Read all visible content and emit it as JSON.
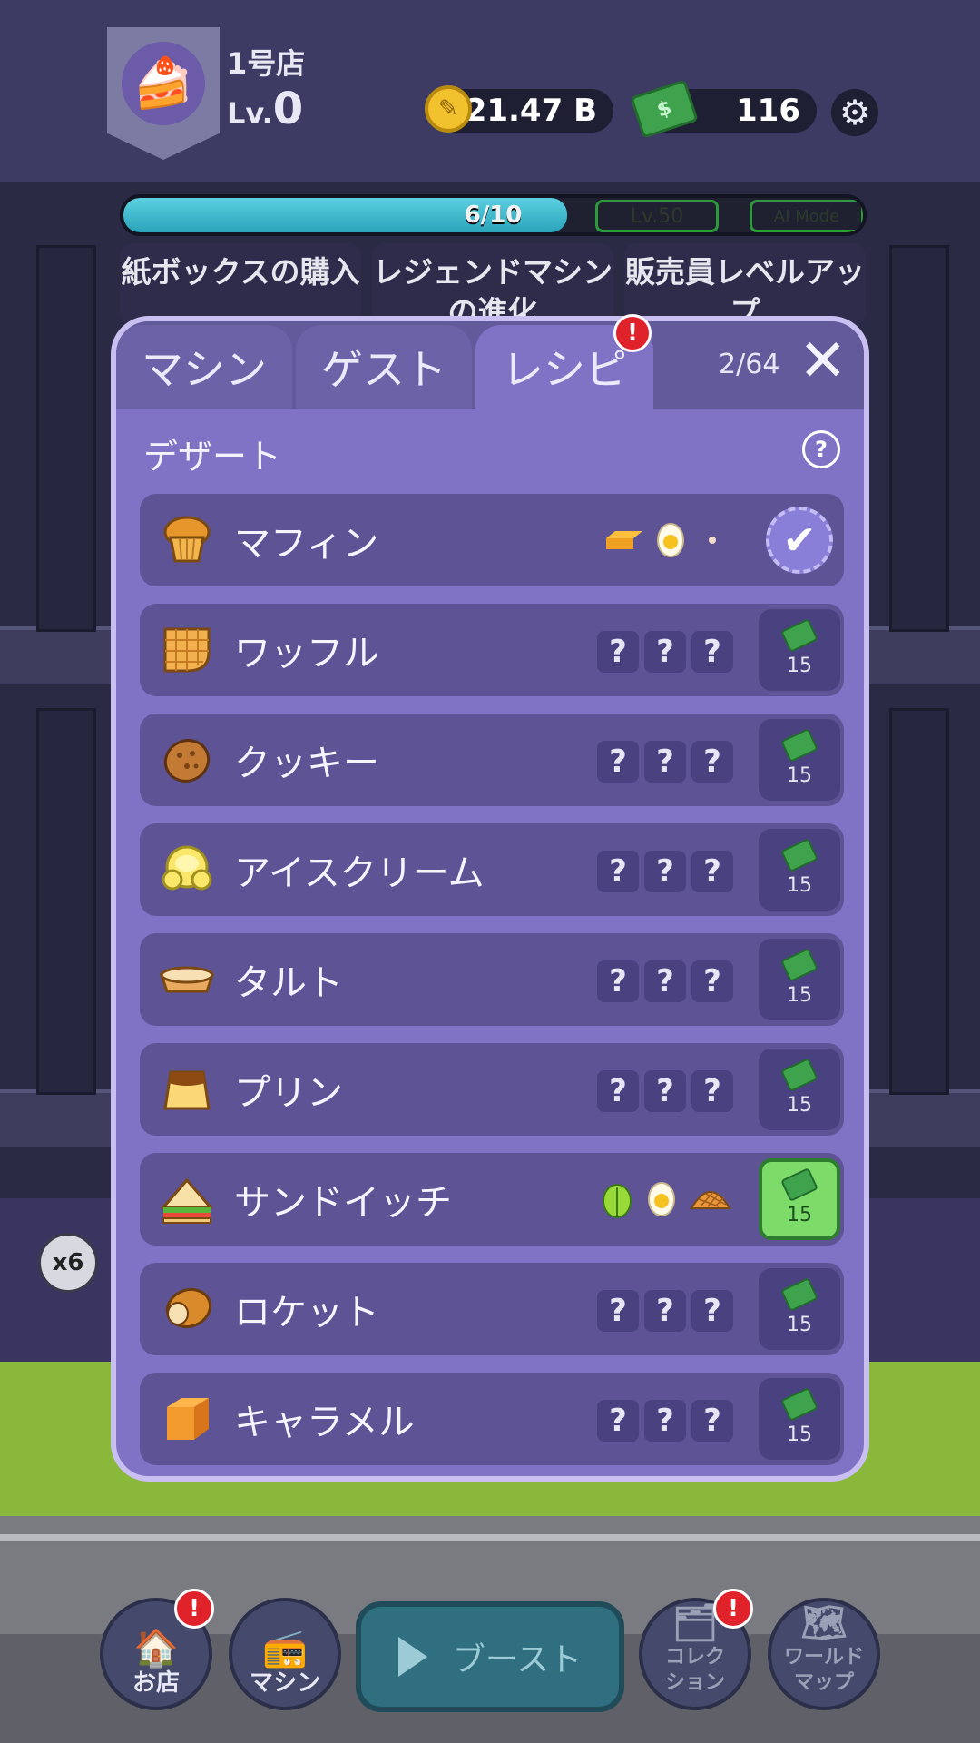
{
  "header": {
    "store_name": "1号店",
    "level_prefix": "Lv.",
    "level_value": "0",
    "coins": "21.47 B",
    "cash": "116"
  },
  "progress": {
    "text": "6/10",
    "fraction": 0.6,
    "milestone_lv": "Lv.50",
    "milestone_ai": "AI Mode"
  },
  "tasks": [
    {
      "label": "紙ボックスの購入"
    },
    {
      "label": "レジェンドマシンの進化"
    },
    {
      "label": "販売員レベルアップ"
    }
  ],
  "dialog": {
    "tabs": [
      {
        "label": "マシン"
      },
      {
        "label": "ゲスト"
      },
      {
        "label": "レシピ"
      }
    ],
    "tab_badge": "!",
    "count": "2/64",
    "close": "✕",
    "section_title": "デザート",
    "help": "?",
    "recipes": [
      {
        "name": "マフィン",
        "status": "unlocked",
        "price": ""
      },
      {
        "name": "ワッフル",
        "status": "locked",
        "price": "15"
      },
      {
        "name": "クッキー",
        "status": "locked",
        "price": "15"
      },
      {
        "name": "アイスクリーム",
        "status": "locked",
        "price": "15"
      },
      {
        "name": "タルト",
        "status": "locked",
        "price": "15"
      },
      {
        "name": "プリン",
        "status": "locked",
        "price": "15"
      },
      {
        "name": "サンドイッチ",
        "status": "available",
        "price": "15"
      },
      {
        "name": "ロケット",
        "status": "locked",
        "price": "15"
      },
      {
        "name": "キャラメル",
        "status": "locked",
        "price": "15"
      }
    ],
    "unknown": "?"
  },
  "queue": "x6",
  "nav": {
    "shop": "お店",
    "machine": "マシン",
    "boost": "ブースト",
    "collection": "コレクション",
    "world_map": "ワールドマップ",
    "badge": "!"
  }
}
